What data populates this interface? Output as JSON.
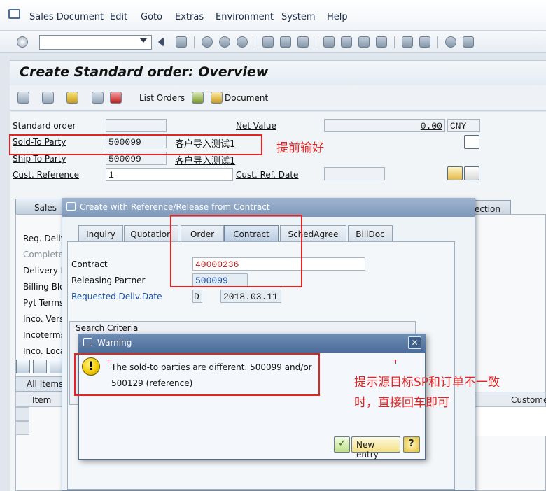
{
  "menu": {
    "items": [
      "Sales Document",
      "Edit",
      "Goto",
      "Extras",
      "Environment",
      "System",
      "Help"
    ]
  },
  "toolbar": {
    "command_value": ""
  },
  "page": {
    "title": "Create Standard order: Overview"
  },
  "app_toolbar": {
    "list_orders": "List Orders",
    "document": "Document"
  },
  "header": {
    "order_type_label": "Standard order",
    "order_type_value": "",
    "net_value_label": "Net Value",
    "net_value": "0.00",
    "currency": "CNY",
    "sold_to_label": "Sold-To Party",
    "sold_to_value": "500099",
    "sold_to_name": "客户导入测试1",
    "ship_to_label": "Ship-To Party",
    "ship_to_value": "500099",
    "ship_to_name": "客户导入测试1",
    "cust_ref_label": "Cust. Reference",
    "cust_ref_value": "1",
    "cust_ref_date_label": "Cust. Ref. Date",
    "cust_ref_date_value": ""
  },
  "main_tabs": {
    "sales": "Sales",
    "selection_partial": "ection"
  },
  "sales_panel": {
    "labels": [
      "Req. Deliv",
      "Complete",
      "Delivery B",
      "Billing Blo",
      "Pyt Terms",
      "Inco. Vers",
      "Incoterms",
      "Inco. Loca"
    ],
    "all_items": "All Items",
    "item_col": "Item",
    "customer_col": "Custome"
  },
  "ref_dialog": {
    "title": "Create with Reference/Release from Contract",
    "tabs": [
      "Inquiry",
      "Quotation",
      "Order",
      "Contract",
      "SchedAgree",
      "BillDoc"
    ],
    "active_tab": "Contract",
    "contract_label": "Contract",
    "contract_value": "40000236",
    "releasing_partner_label": "Releasing Partner",
    "releasing_partner_value": "500099",
    "req_deliv_label": "Requested Deliv.Date",
    "req_deliv_type": "D",
    "req_deliv_value": "2018.03.11",
    "search_criteria": "Search Criteria"
  },
  "warning": {
    "title": "Warning",
    "line1": "The sold-to parties are different. 500099 and/or",
    "line2": "500129 (reference)",
    "new_entry": "New entry"
  },
  "annotations": {
    "note1": "提前输好",
    "note2_line1": "提示源目标SP和订单不一致",
    "note2_line2": "时，直接回车即可"
  },
  "colors": {
    "annotation": "#e52323",
    "link_blue": "#1a4fa6",
    "dialog_header": "#7f98ba",
    "warning_header": "#4b6d9a"
  }
}
